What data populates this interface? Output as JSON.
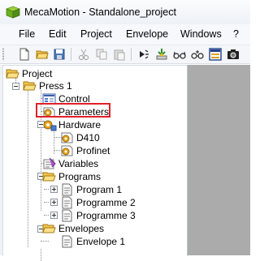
{
  "window": {
    "title": "MecaMotion - Standalone_project"
  },
  "menu": [
    "File",
    "Edit",
    "Project",
    "Envelope",
    "Windows",
    "?"
  ],
  "toolbar": {
    "icons": [
      "new-file-icon",
      "open-folder-icon",
      "save-icon",
      "cut-icon",
      "copy-icon",
      "paste-icon",
      "run-icon",
      "download-icon",
      "glasses-icon",
      "glasses-find-icon",
      "panel-icon",
      "camera-icon"
    ]
  },
  "tree": {
    "root": "Project",
    "press": "Press 1",
    "control": "Control",
    "parameters": "Parameters",
    "hardware": "Hardware",
    "d410": "D410",
    "profinet": "Profinet",
    "variables": "Variables",
    "programs": "Programs",
    "program1": "Program 1",
    "programme2": "Programme 2",
    "programme3": "Programme 3",
    "envelopes": "Envelopes",
    "envelope1": "Envelope 1"
  },
  "colors": {
    "highlight": "#e0212a",
    "right_pane": "#ababab"
  }
}
